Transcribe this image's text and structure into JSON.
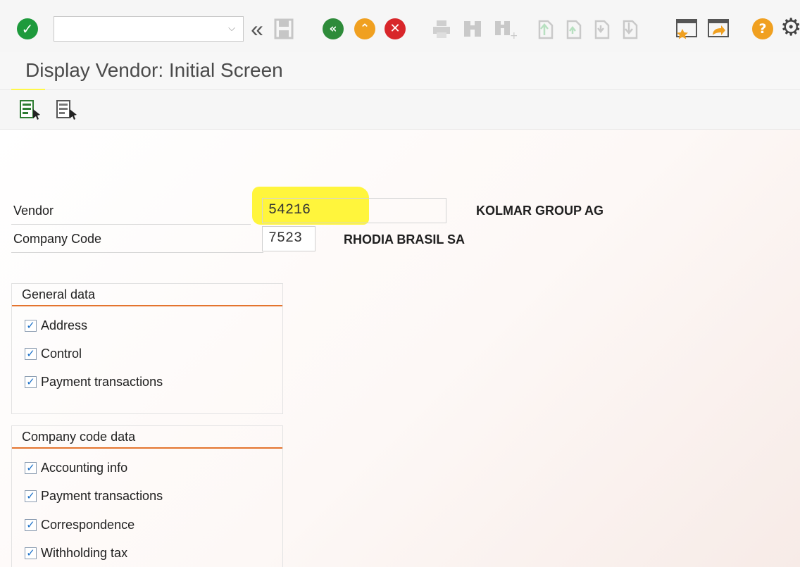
{
  "toolbar": {
    "command_field": {
      "value": "",
      "placeholder": ""
    },
    "icons": {
      "enter": "check-icon",
      "back_arrows": "double-chevron-left-icon",
      "save": "save-icon",
      "back": "back-icon",
      "exit": "exit-icon",
      "cancel": "cancel-icon",
      "print": "print-icon",
      "find": "find-icon",
      "find_next": "find-next-icon",
      "first_page": "first-page-icon",
      "previous_page": "previous-page-icon",
      "next_page": "next-page-icon",
      "last_page": "last-page-icon",
      "new_session": "new-session-icon",
      "shortcut": "shortcut-icon",
      "help": "help-icon",
      "settings": "settings-icon"
    }
  },
  "title": "Display Vendor:  Initial Screen",
  "app_toolbar": {
    "icons": {
      "select_all": "select-all-icon",
      "deselect_all": "deselect-all-icon"
    }
  },
  "form": {
    "vendor": {
      "label": "Vendor",
      "value": "54216",
      "description": "KOLMAR GROUP AG"
    },
    "company_code": {
      "label": "Company Code",
      "value": "7523",
      "description": "RHODIA BRASIL SA"
    }
  },
  "groups": [
    {
      "title": "General data",
      "items": [
        {
          "label": "Address",
          "checked": true
        },
        {
          "label": "Control",
          "checked": true
        },
        {
          "label": "Payment transactions",
          "checked": true
        }
      ]
    },
    {
      "title": "Company code data",
      "items": [
        {
          "label": "Accounting info",
          "checked": true
        },
        {
          "label": "Payment transactions",
          "checked": true
        },
        {
          "label": "Correspondence",
          "checked": true
        },
        {
          "label": "Withholding tax",
          "checked": true
        }
      ]
    }
  ],
  "colors": {
    "enter_green": "#1e9a3c",
    "nav_green": "#2e8b3a",
    "exit_orange": "#f0a020",
    "cancel_red": "#d8262a",
    "highlight_yellow": "#fff53c",
    "group_underline": "#e4742e"
  }
}
